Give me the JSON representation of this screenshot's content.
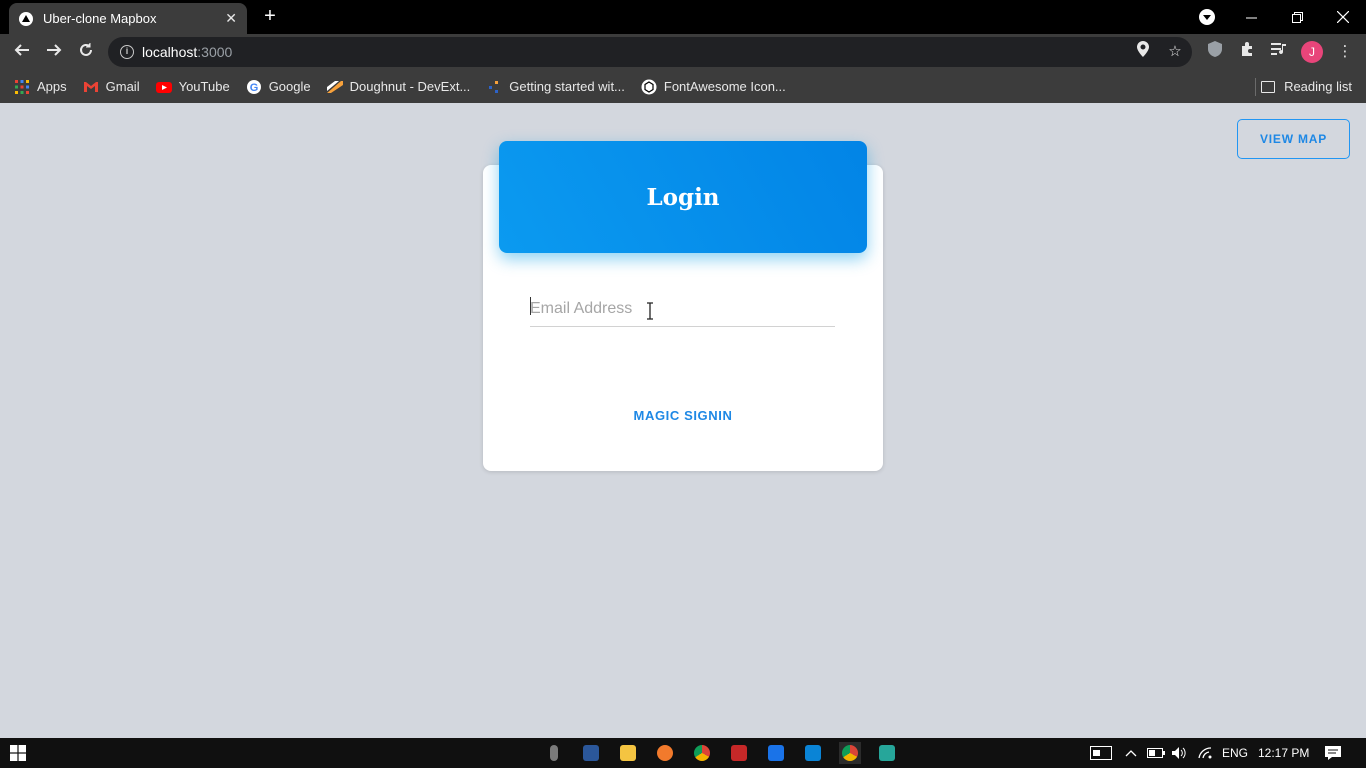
{
  "browser": {
    "tab_title": "Uber-clone Mapbox",
    "tab_close": "✕",
    "new_tab": "+",
    "url_host": "localhost",
    "url_port": ":3000",
    "avatar_initial": "J",
    "reading_list": "Reading list",
    "bookmarks": [
      {
        "label": "Apps",
        "icon": "apps-grid-icon",
        "color": "#f4b400"
      },
      {
        "label": "Gmail",
        "icon": "gmail-icon",
        "color": "#ea4335"
      },
      {
        "label": "YouTube",
        "icon": "youtube-icon",
        "color": "#ff0000"
      },
      {
        "label": "Google",
        "icon": "google-icon",
        "color": "#4285f4"
      },
      {
        "label": "Doughnut - DevExt...",
        "icon": "devextreme-icon",
        "color": "#f7a13b"
      },
      {
        "label": "Getting started wit...",
        "icon": "bootstrap-icon",
        "color": "#2d63c8"
      },
      {
        "label": "FontAwesome Icon...",
        "icon": "codepen-icon",
        "color": "#ffffff"
      }
    ]
  },
  "page": {
    "view_map": "VIEW MAP",
    "login_title": "Login",
    "email_placeholder": "Email Address",
    "magic_signin": "MAGIC SIGNIN",
    "accent_color": "#039be5"
  },
  "taskbar": {
    "language": "ENG",
    "time": "12:17 PM"
  }
}
